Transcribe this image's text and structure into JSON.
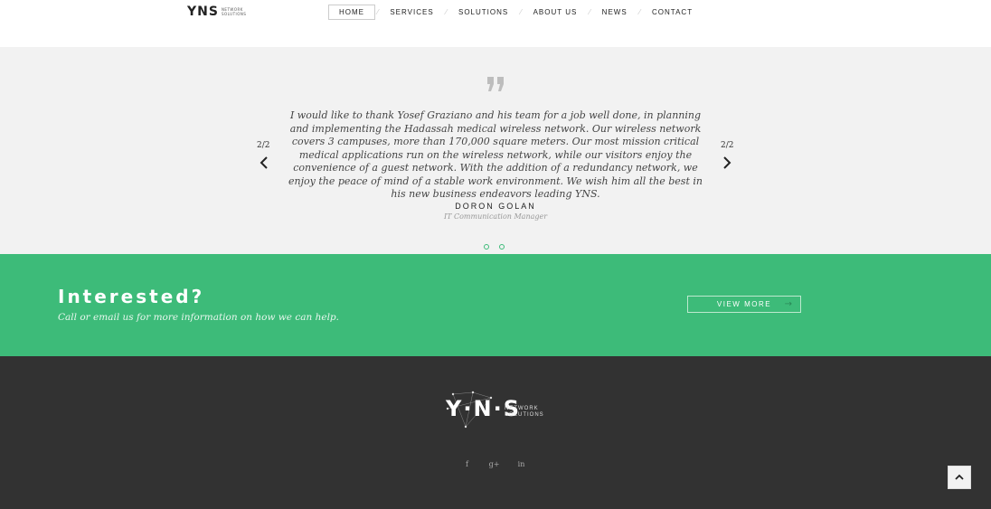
{
  "header": {
    "logo": {
      "mark": "YNS",
      "sub_line1": "NETWORK",
      "sub_line2": "SOLUTIONS"
    },
    "nav": [
      {
        "label": "HOME",
        "active": true
      },
      {
        "label": "SERVICES",
        "active": false
      },
      {
        "label": "SOLUTIONS",
        "active": false
      },
      {
        "label": "ABOUT US",
        "active": false
      },
      {
        "label": "NEWS",
        "active": false
      },
      {
        "label": "CONTACT",
        "active": false
      }
    ]
  },
  "testimonial": {
    "quote_icon": "quote-icon",
    "text": "I would like to thank Yosef Graziano and his team for a job well done, in planning and implementing the Hadassah medical wireless network. Our wireless network covers 3 campuses, more than 170,000 square meters. Our most mission critical medical applications run on the wireless network, while our visitors enjoy the convenience of a guest network. With the addition of a redundancy network, we enjoy the peace of mind of a stable work environment. We wish him all the best in his new business endeavors leading YNS.",
    "author": "DORON GOLAN",
    "role": "IT Communication Manager",
    "counter_left": "2/2",
    "counter_right": "2/2",
    "prev_icon": "chevron-left-icon",
    "next_icon": "chevron-right-icon",
    "slide_count": 2
  },
  "cta": {
    "title": "Interested?",
    "subtitle": "Call or email us for more information on how we can help.",
    "button_label": "VIEW MORE",
    "button_icon": "arrow-right-icon",
    "color": "#3dbb79"
  },
  "footer": {
    "logo": {
      "mark": "Y·N·S",
      "sub_line1": "NETWORK",
      "sub_line2": "SOLUTIONS"
    },
    "socials": [
      {
        "label": "f",
        "icon": "facebook-icon"
      },
      {
        "label": "g+",
        "icon": "google-plus-icon"
      },
      {
        "label": "in",
        "icon": "linkedin-icon"
      }
    ],
    "background": "#323232"
  },
  "scroll_top": {
    "icon": "chevron-up-icon"
  }
}
